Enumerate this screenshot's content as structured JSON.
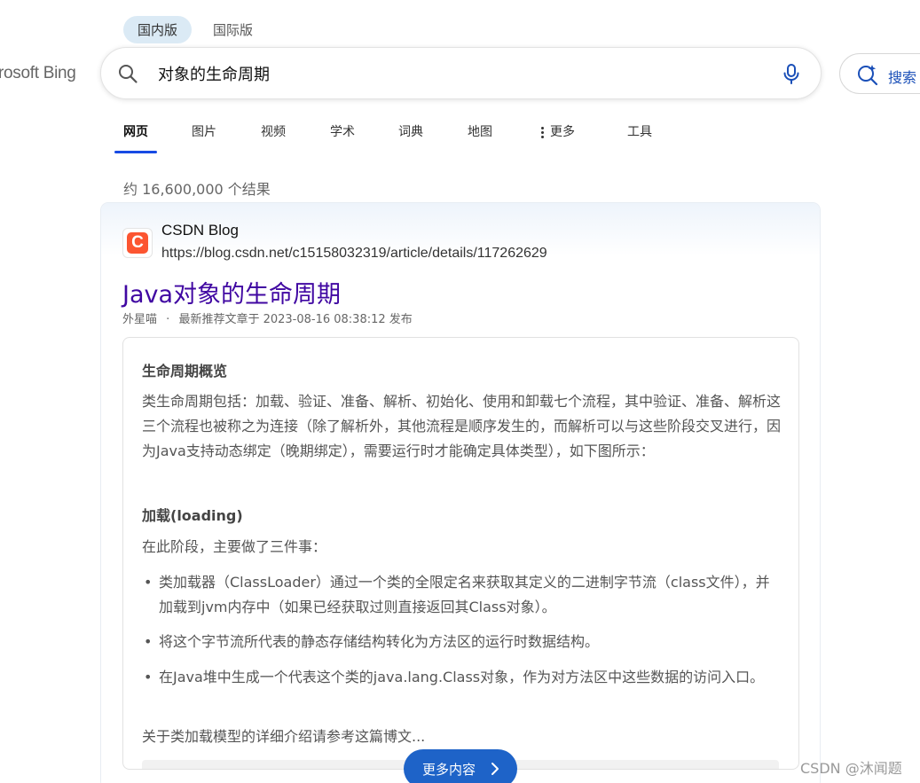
{
  "logo_text": "rosoft Bing",
  "region_tabs": [
    {
      "label": "国内版",
      "active": true
    },
    {
      "label": "国际版",
      "active": false
    }
  ],
  "search": {
    "value": "对象的生命周期",
    "placeholder": ""
  },
  "copilot": {
    "label": "搜索"
  },
  "nav": {
    "items": [
      "网页",
      "图片",
      "视频",
      "学术",
      "词典",
      "地图",
      "更多",
      "工具"
    ],
    "active": "网页"
  },
  "result_count": "约 16,600,000 个结果",
  "result": {
    "favicon_letter": "C",
    "site_name": "CSDN Blog",
    "url": "https://blog.csdn.net/c15158032319/article/details/117262629",
    "title": "Java对象的生命周期",
    "author": "外星喵",
    "meta_sep": "·",
    "meta": "最新推荐文章于 2023-08-16 08:38:12 发布",
    "snippet": {
      "heading1": "生命周期概览",
      "para1": "类生命周期包括：加载、验证、准备、解析、初始化、使用和卸载七个流程，其中验证、准备、解析这三个流程也被称之为连接（除了解析外，其他流程是顺序发生的，而解析可以与这些阶段交叉进行，因为Java支持动态绑定（晚期绑定），需要运行时才能确定具体类型），如下图所示：",
      "heading2": "加载(loading)",
      "para2": "在此阶段，主要做了三件事：",
      "bullets": [
        "类加载器（ClassLoader）通过一个类的全限定名来获取其定义的二进制字节流（class文件），并加载到jvm内存中（如果已经获取过则直接返回其Class对象）。",
        "将这个字节流所代表的静态存储结构转化为方法区的运行时数据结构。",
        "在Java堆中生成一个代表这个类的java.lang.Class对象，作为对方法区中这些数据的访问入口。"
      ],
      "para3": "关于类加载模型的详细介绍请参考这篇博文..."
    },
    "more_label": "更多内容"
  },
  "watermark": "CSDN @沐闻题",
  "colors": {
    "accent_blue": "#174ae4",
    "title_purple": "#4007a2",
    "csdn_red": "#fc5531",
    "button_blue": "#1e63c8"
  },
  "icons": [
    "search-icon",
    "microphone-icon",
    "copilot-search-icon",
    "more-dots-icon",
    "chevron-right-icon"
  ]
}
